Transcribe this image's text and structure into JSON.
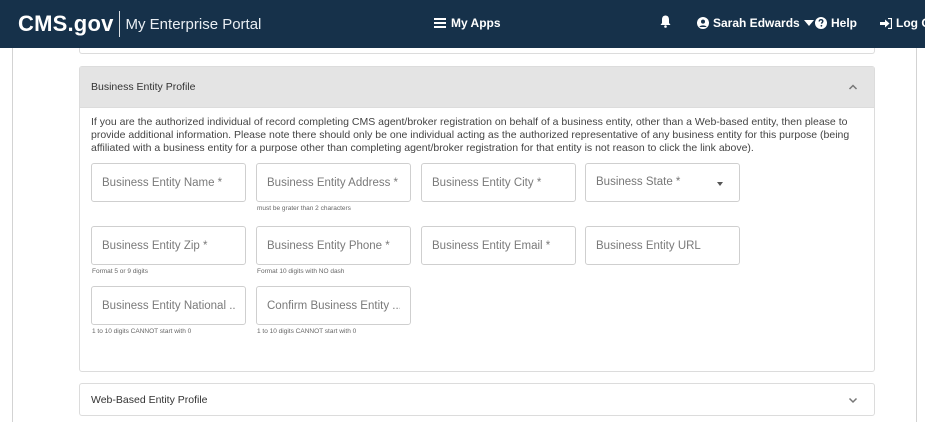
{
  "nav": {
    "logo": "CMS.gov",
    "portal": "My Enterprise Portal",
    "my_apps": "My Apps",
    "user_name": "Sarah Edwards",
    "help": "Help",
    "logout": "Log Out",
    "icons": {
      "apps": "list-icon",
      "bell": "bell-icon",
      "user": "user-circle-icon",
      "caret": "caret-down-icon",
      "help": "question-circle-icon",
      "logout": "sign-out-icon"
    }
  },
  "business_entity": {
    "title": "Business Entity Profile",
    "intro": "If you are the authorized individual of record completing CMS agent/broker registration on behalf of a business entity, other than a Web-based entity, then please to provide additional information. Please note there should only be one individual acting as the authorized representative of any business entity for this purpose (being affiliated with a business entity for a purpose other than completing agent/broker registration for that entity is not reason to click the link above).",
    "fields": {
      "name": {
        "placeholder": "Business Entity Name *"
      },
      "address": {
        "placeholder": "Business Entity Address *",
        "helper": "must be grater than 2 characters"
      },
      "city": {
        "placeholder": "Business Entity City *"
      },
      "state": {
        "placeholder": "Business State *"
      },
      "zip": {
        "placeholder": "Business Entity Zip *",
        "helper": "Format 5 or 9 digits"
      },
      "phone": {
        "placeholder": "Business Entity Phone *",
        "helper": "Format 10 digits with NO dash"
      },
      "email": {
        "placeholder": "Business Entity Email *"
      },
      "url": {
        "placeholder": "Business Entity URL"
      },
      "npn": {
        "placeholder": "Business Entity National ...",
        "helper": "1 to 10 digits CANNOT start with 0"
      },
      "confirm_npn": {
        "placeholder": "Confirm Business Entity ...",
        "helper": "1 to 10 digits CANNOT start with 0"
      }
    }
  },
  "web_entity": {
    "title": "Web-Based Entity Profile"
  },
  "colors": {
    "nav_bg": "#16314a",
    "header_bg": "#e4e4e4",
    "border": "#dcdcdc"
  }
}
